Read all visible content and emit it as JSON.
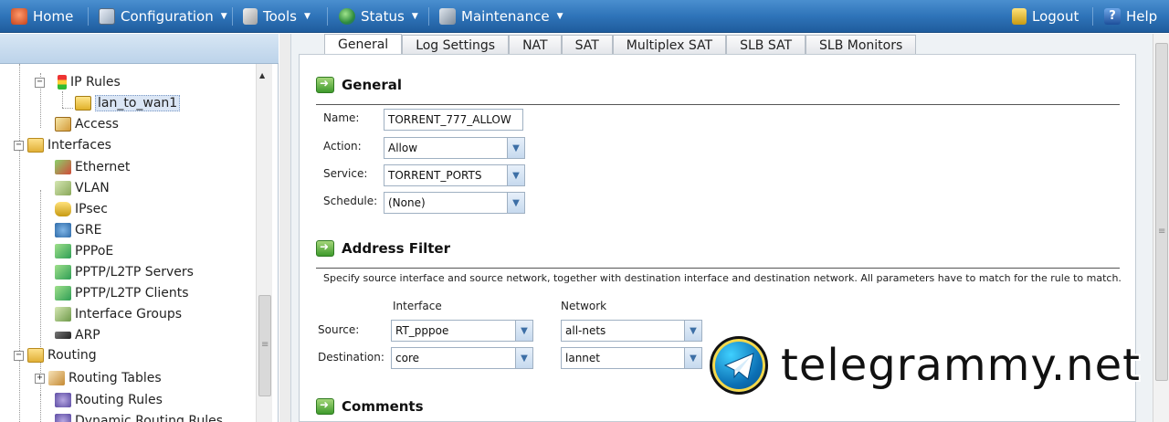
{
  "menu": {
    "home": "Home",
    "configuration": "Configuration",
    "tools": "Tools",
    "status": "Status",
    "maintenance": "Maintenance",
    "logout": "Logout",
    "help": "Help"
  },
  "tree": {
    "ip_rules": "IP Rules",
    "lan_to_wan1": "lan_to_wan1",
    "access": "Access",
    "interfaces": "Interfaces",
    "ethernet": "Ethernet",
    "vlan": "VLAN",
    "ipsec": "IPsec",
    "gre": "GRE",
    "pppoe": "PPPoE",
    "pptp_servers": "PPTP/L2TP Servers",
    "pptp_clients": "PPTP/L2TP Clients",
    "interface_groups": "Interface Groups",
    "arp": "ARP",
    "routing": "Routing",
    "routing_tables": "Routing Tables",
    "routing_rules": "Routing Rules",
    "dynamic_routing_rules": "Dynamic Routing Rules"
  },
  "tabs": [
    "General",
    "Log Settings",
    "NAT",
    "SAT",
    "Multiplex SAT",
    "SLB SAT",
    "SLB Monitors"
  ],
  "general": {
    "title": "General",
    "name_label": "Name:",
    "name_value": "TORRENT_777_ALLOW",
    "action_label": "Action:",
    "action_value": "Allow",
    "service_label": "Service:",
    "service_value": "TORRENT_PORTS",
    "schedule_label": "Schedule:",
    "schedule_value": "(None)"
  },
  "address_filter": {
    "title": "Address Filter",
    "description": "Specify source interface and source network, together with destination interface and destination network. All parameters have to match for the rule to match.",
    "col_interface": "Interface",
    "col_network": "Network",
    "source_label": "Source:",
    "source_interface": "RT_pppoe",
    "source_network": "all-nets",
    "destination_label": "Destination:",
    "destination_interface": "core",
    "destination_network": "lannet"
  },
  "comments": {
    "title": "Comments"
  },
  "watermark": "telegrammy.net"
}
